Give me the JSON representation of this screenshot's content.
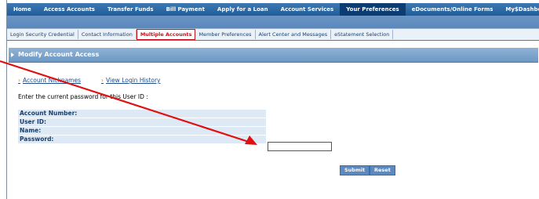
{
  "topnav": {
    "items": [
      "Home",
      "Access Accounts",
      "Transfer Funds",
      "Bill Payment",
      "Apply for a Loan",
      "Account Services",
      "Your Preferences",
      "eDocuments/Online Forms",
      "My$Dashboard"
    ],
    "active": "Your Preferences"
  },
  "subnav": {
    "items": [
      "Login Security Credential",
      "Contact Information",
      "Multiple Accounts",
      "Member Preferences",
      "Alert Center and Messages",
      "eStatement Selection"
    ],
    "active": "Multiple Accounts"
  },
  "page": {
    "title": "Modify Account Access",
    "links": [
      "Account Nicknames",
      "View Login History"
    ],
    "instruction": "Enter the current password for this User ID :"
  },
  "form": {
    "rows": [
      "Account Number:",
      "User ID:",
      "Name:",
      "Password:"
    ],
    "password_value": ""
  },
  "buttons": {
    "submit": "Submit",
    "reset": "Reset"
  },
  "colors": {
    "nav": "#1f5e9a",
    "active_nav": "#0d3c73",
    "highlight": "#c4121a",
    "annotation_arrow": "#e01010"
  }
}
